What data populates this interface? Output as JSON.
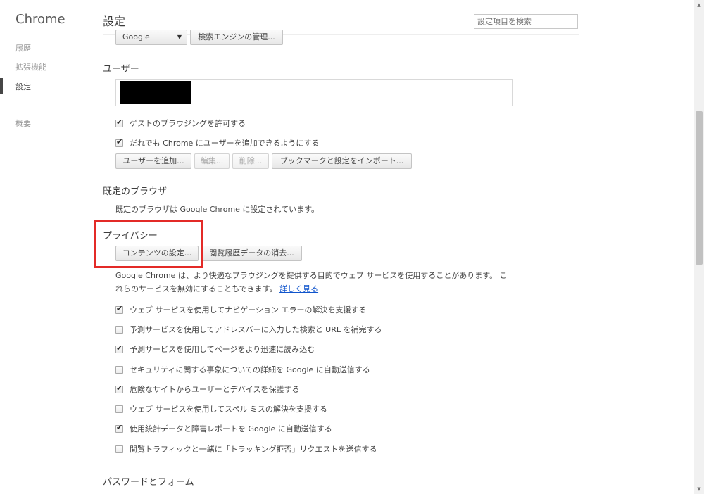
{
  "app": {
    "name": "Chrome"
  },
  "sidebar": {
    "items": [
      {
        "label": "履歴"
      },
      {
        "label": "拡張機能"
      },
      {
        "label": "設定"
      },
      {
        "label": "概要"
      }
    ]
  },
  "header": {
    "title": "設定",
    "search_placeholder": "設定項目を検索"
  },
  "search_engine": {
    "selected": "Google",
    "manage_button": "検索エンジンの管理..."
  },
  "users": {
    "title": "ユーザー",
    "checkboxes": [
      {
        "label": "ゲストのブラウジングを許可する",
        "checked": true
      },
      {
        "label": "だれでも Chrome にユーザーを追加できるようにする",
        "checked": true
      }
    ],
    "buttons": {
      "add": "ユーザーを追加...",
      "edit": "編集...",
      "delete": "削除...",
      "import": "ブックマークと設定をインポート..."
    }
  },
  "default_browser": {
    "title": "既定のブラウザ",
    "status": "既定のブラウザは Google Chrome に設定されています。"
  },
  "privacy": {
    "title": "プライバシー",
    "content_settings_button": "コンテンツの設定...",
    "clear_history_button": "閲覧履歴データの消去...",
    "description_line1": "Google Chrome は、より快適なブラウジングを提供する目的でウェブ サービスを使用することがあります。 こ",
    "description_line2": "れらのサービスを無効にすることもできます。",
    "learn_more": "詳しく見る",
    "checkboxes": [
      {
        "label": "ウェブ サービスを使用してナビゲーション エラーの解決を支援する",
        "checked": true
      },
      {
        "label": "予測サービスを使用してアドレスバーに入力した検索と URL を補完する",
        "checked": false
      },
      {
        "label": "予測サービスを使用してページをより迅速に読み込む",
        "checked": true
      },
      {
        "label": "セキュリティに関する事象についての詳細を Google に自動送信する",
        "checked": false
      },
      {
        "label": "危険なサイトからユーザーとデバイスを保護する",
        "checked": true
      },
      {
        "label": "ウェブ サービスを使用してスペル ミスの解決を支援する",
        "checked": false
      },
      {
        "label": "使用統計データと障害レポートを Google に自動送信する",
        "checked": true
      },
      {
        "label": "閲覧トラフィックと一緒に「トラッキング拒否」リクエストを送信する",
        "checked": false
      }
    ]
  },
  "passwords": {
    "title": "パスワードとフォーム"
  },
  "icons": {
    "check": "✔",
    "dropdown": "▼",
    "scroll_up": "▲",
    "scroll_down": "▼"
  },
  "colors": {
    "highlight": "#e32a27",
    "link": "#1155cc"
  }
}
